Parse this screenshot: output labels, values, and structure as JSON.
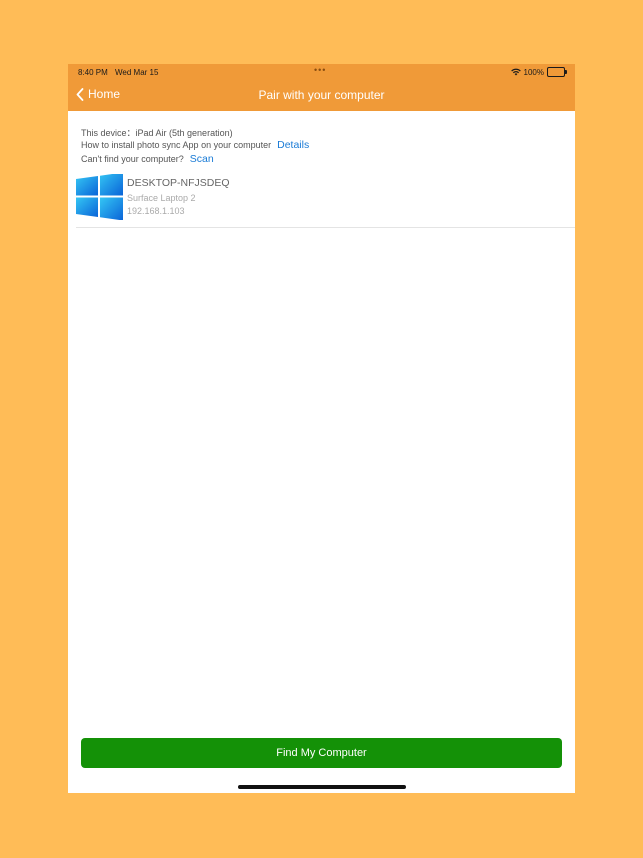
{
  "status_bar": {
    "time": "8:40 PM",
    "date": "Wed Mar 15",
    "dots": "•••",
    "battery_text": "100%",
    "icons": [
      "wifi-icon",
      "battery-icon"
    ]
  },
  "nav": {
    "back_label": "Home",
    "back_icon": "chevron-left-icon",
    "title": "Pair with your computer"
  },
  "info": {
    "device_line": "This device：iPad Air (5th generation)",
    "install_text": "How to install photo sync App on your computer",
    "details_link": "Details",
    "cant_find_text": "Can't find your computer?",
    "scan_link": "Scan"
  },
  "computers": [
    {
      "name": "DESKTOP-NFJSDEQ",
      "model": "Surface Laptop 2",
      "ip": "192.168.1.103",
      "icon": "windows-logo-icon"
    }
  ],
  "footer": {
    "find_button_label": "Find My Computer"
  },
  "colors": {
    "background": "#FFBC57",
    "header": "#F09A38",
    "link": "#1a7bd6",
    "button": "#149107"
  }
}
